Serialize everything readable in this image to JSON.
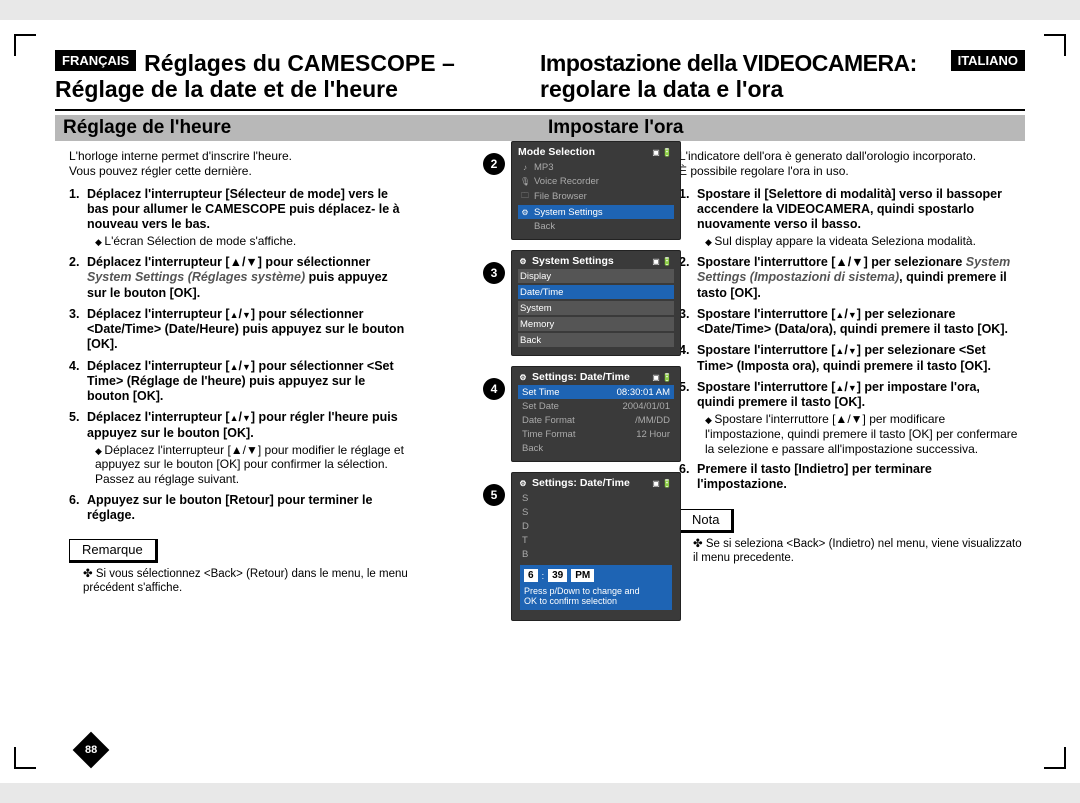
{
  "header": {
    "fr": {
      "lang": "FRANÇAIS",
      "line1": "Réglages du CAMESCOPE –",
      "line2": "Réglage de la date et de l'heure"
    },
    "it": {
      "lang": "ITALIANO",
      "line1": "Impostazione della VIDEOCAMERA:",
      "line2": "regolare la data e l'ora"
    }
  },
  "subhead": {
    "fr": "Réglage de l'heure",
    "it": "Impostare l'ora"
  },
  "intro": {
    "fr": "L'horloge interne permet d'inscrire l'heure.\nVous pouvez régler cette dernière.",
    "it": "L'indicatore dell'ora è generato dall'orologio incorporato.\nÈ possibile regolare l'ora in uso."
  },
  "fr_steps": [
    {
      "n": "1.",
      "bold": "Déplacez l'interrupteur [Sélecteur de mode] vers le bas pour allumer le CAMESCOPE puis déplacez- le à nouveau vers le bas.",
      "sub": [
        "L'écran Sélection de mode s'affiche."
      ]
    },
    {
      "n": "2.",
      "html": "<b>Déplacez l'interrupteur [▲/▼] pour sélectionner </b><span class='em'>System Settings (Réglages système)</span><b> puis appuyez sur le bouton [OK].</b>"
    },
    {
      "n": "3.",
      "bold": "Déplacez l'interrupteur [▲/▼] pour sélectionner <Date/Time> (Date/Heure) puis appuyez sur le bouton [OK]."
    },
    {
      "n": "4.",
      "bold": "Déplacez l'interrupteur [▲/▼] pour sélectionner <Set Time> (Réglage de l'heure) puis appuyez sur le bouton [OK]."
    },
    {
      "n": "5.",
      "bold": "Déplacez l'interrupteur [▲/▼] pour régler l'heure puis appuyez sur le bouton [OK].",
      "sub": [
        "Déplacez l'interrupteur [▲/▼] pour modifier le réglage et appuyez sur le bouton [OK] pour confirmer la sélection. Passez au réglage suivant."
      ]
    },
    {
      "n": "6.",
      "bold": "Appuyez sur le bouton [Retour] pour terminer le réglage."
    }
  ],
  "it_steps": [
    {
      "n": "1.",
      "bold": "Spostare il [Selettore di modalità] verso il bassoper accendere la VIDEOCAMERA, quindi spostarlo nuovamente verso il basso.",
      "sub": [
        "Sul display appare la videata Seleziona modalità."
      ]
    },
    {
      "n": "2.",
      "html": "<b>Spostare l'interruttore [▲/▼] per selezionare </b><span class='em'>System Settings (Impostazioni di sistema)</span><b>, quindi premere il tasto [OK].</b>"
    },
    {
      "n": "3.",
      "bold": "Spostare l'interruttore [▲/▼] per selezionare <Date/Time> (Data/ora), quindi premere il tasto [OK]."
    },
    {
      "n": "4.",
      "bold": "Spostare l'interruttore [▲/▼] per selezionare <Set Time> (Imposta ora), quindi premere il tasto [OK]."
    },
    {
      "n": "5.",
      "bold": "Spostare l'interruttore [▲/▼] per impostare l'ora, quindi premere il tasto [OK].",
      "sub": [
        "Spostare l'interruttore [▲/▼] per modificare l'impostazione, quindi premere il tasto [OK] per confermare la selezione e passare all'impostazione successiva."
      ]
    },
    {
      "n": "6.",
      "bold": "Premere il tasto [Indietro] per terminare l'impostazione."
    }
  ],
  "note": {
    "fr_label": "Remarque",
    "fr_text": "Si vous sélectionnez <Back> (Retour) dans le menu, le menu précédent s'affiche.",
    "it_label": "Nota",
    "it_text": "Se si seleziona <Back> (Indietro) nel menu, viene visualizzato il menu precedente."
  },
  "screens": {
    "s2": {
      "badge": "2",
      "title": "Mode Selection",
      "items": [
        {
          "icon": "♪",
          "label": "MP3"
        },
        {
          "icon": "🎙",
          "label": "Voice Recorder"
        },
        {
          "icon": "🗀",
          "label": "File Browser"
        },
        {
          "icon": "⚙",
          "label": "System Settings",
          "sel": true
        },
        {
          "icon": "",
          "label": "Back"
        }
      ]
    },
    "s3": {
      "badge": "3",
      "title": "System Settings",
      "items": [
        {
          "label": "Display"
        },
        {
          "label": "Date/Time",
          "sel": true
        },
        {
          "label": "System"
        },
        {
          "label": "Memory"
        },
        {
          "label": "Back"
        }
      ]
    },
    "s4": {
      "badge": "4",
      "title": "Settings: Date/Time",
      "rows": [
        {
          "k": "Set Time",
          "v": "08:30:01 AM",
          "sel": true
        },
        {
          "k": "Set Date",
          "v": "2004/01/01"
        },
        {
          "k": "Date Format",
          "v": "/MM/DD"
        },
        {
          "k": "Time Format",
          "v": "12 Hour"
        },
        {
          "k": "Back",
          "v": ""
        }
      ]
    },
    "s5": {
      "badge": "5",
      "title": "Settings: Date/Time",
      "popup": {
        "h": "6",
        "m": "39",
        "ap": "PM",
        "line1": "Press    p/Down to change and",
        "line2": "OK to confirm selection"
      },
      "bg_rows": [
        "S",
        "S",
        "D",
        "T",
        "B"
      ]
    }
  },
  "page_number": "88"
}
